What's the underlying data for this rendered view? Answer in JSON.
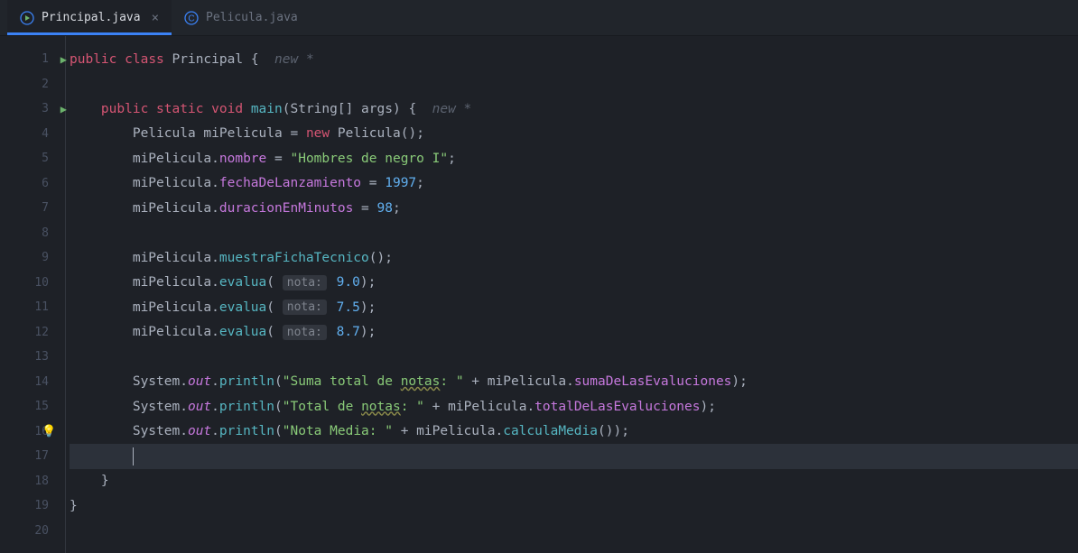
{
  "tabs": [
    {
      "label": "Principal.java",
      "active": true,
      "iconColor": "#3b82f6"
    },
    {
      "label": "Pelicula.java",
      "active": false,
      "iconColor": "#3b82f6"
    }
  ],
  "code": {
    "line1": {
      "kw_public": "public",
      "kw_class": "class",
      "name": "Principal",
      "brace": "{",
      "hint": "new *"
    },
    "line3": {
      "kw_public": "public",
      "kw_static": "static",
      "kw_void": "void",
      "method": "main",
      "params": "(String[] args)",
      "brace": "{",
      "hint": "new *"
    },
    "line4": {
      "type": "Pelicula",
      "var": "miPelicula",
      "eq": "=",
      "kw_new": "new",
      "ctor": "Pelicula()",
      "semi": ";"
    },
    "line5": {
      "obj": "miPelicula",
      "dot": ".",
      "field": "nombre",
      "eq": " = ",
      "str": "\"Hombres de negro I\"",
      "semi": ";"
    },
    "line6": {
      "obj": "miPelicula",
      "dot": ".",
      "field": "fechaDeLanzamiento",
      "eq": " = ",
      "num": "1997",
      "semi": ";"
    },
    "line7": {
      "obj": "miPelicula",
      "dot": ".",
      "field": "duracionEnMinutos",
      "eq": " = ",
      "num": "98",
      "semi": ";"
    },
    "line9": {
      "obj": "miPelicula",
      "dot": ".",
      "method": "muestraFichaTecnico",
      "paren": "()",
      "semi": ";"
    },
    "line10": {
      "obj": "miPelicula",
      "dot": ".",
      "method": "evalua",
      "paramHint": "nota:",
      "num": "9.0",
      "semi": ";"
    },
    "line11": {
      "obj": "miPelicula",
      "dot": ".",
      "method": "evalua",
      "paramHint": "nota:",
      "num": "7.5",
      "semi": ";"
    },
    "line12": {
      "obj": "miPelicula",
      "dot": ".",
      "method": "evalua",
      "paramHint": "nota:",
      "num": "8.7",
      "semi": ";"
    },
    "line14": {
      "cls": "System",
      "dot1": ".",
      "out": "out",
      "dot2": ".",
      "println": "println",
      "str": "\"Suma total de ",
      "strWarn": "notas",
      "strEnd": ": \"",
      "plus": " + ",
      "obj": "miPelicula",
      "dot3": ".",
      "field": "sumaDeLasEvaluciones",
      "semi": ";"
    },
    "line15": {
      "cls": "System",
      "dot1": ".",
      "out": "out",
      "dot2": ".",
      "println": "println",
      "str": "\"Total de ",
      "strWarn": "notas",
      "strEnd": ": \"",
      "plus": " + ",
      "obj": "miPelicula",
      "dot3": ".",
      "field": "totalDeLasEvaluciones",
      "semi": ";"
    },
    "line16": {
      "cls": "System",
      "dot1": ".",
      "out": "out",
      "dot2": ".",
      "println": "println",
      "str": "\"Nota Media: \"",
      "plus": " + ",
      "obj": "miPelicula",
      "dot3": ".",
      "method": "calculaMedia",
      "paren": "()",
      "semi": ";"
    },
    "line18": {
      "brace": "}"
    },
    "line19": {
      "brace": "}"
    }
  },
  "lineNumbers": [
    "1",
    "2",
    "3",
    "4",
    "5",
    "6",
    "7",
    "8",
    "9",
    "10",
    "11",
    "12",
    "13",
    "14",
    "15",
    "16",
    "17",
    "18",
    "19",
    "20"
  ]
}
